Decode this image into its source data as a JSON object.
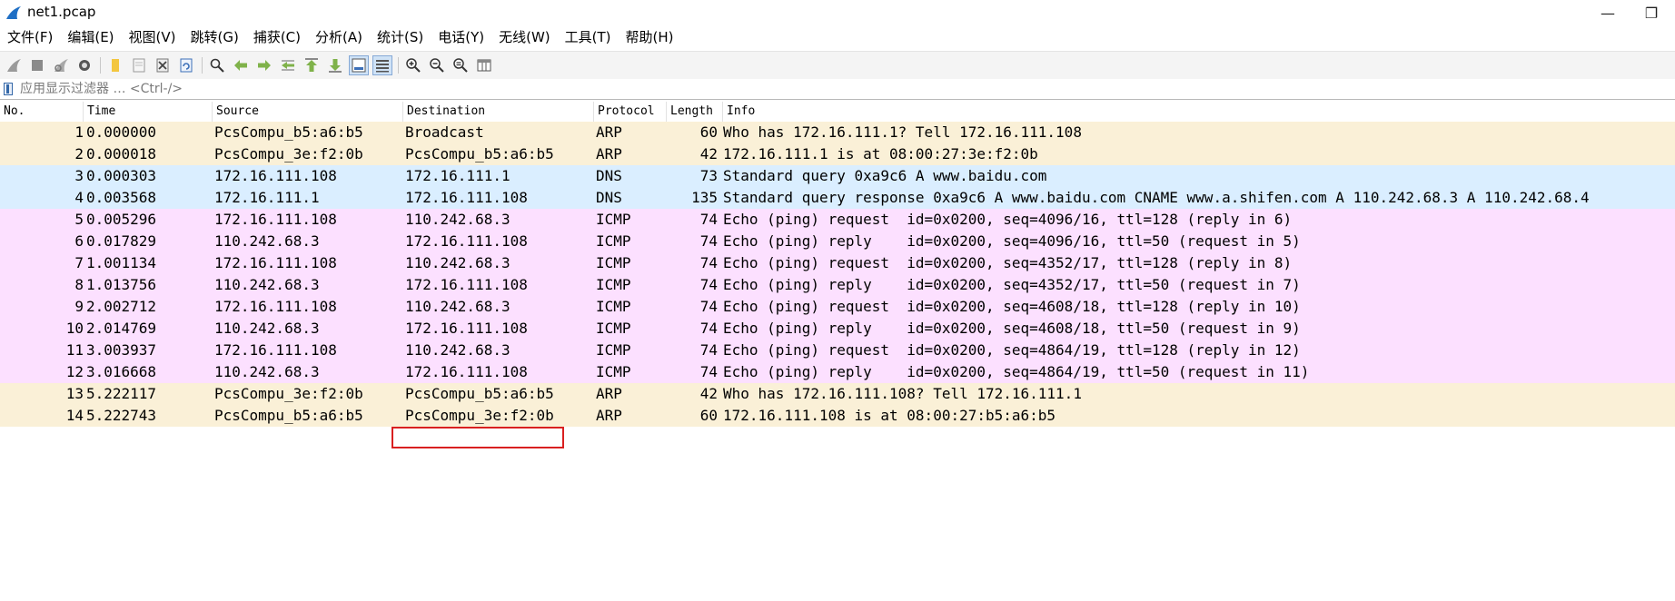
{
  "window": {
    "title": "net1.pcap",
    "minimize_glyph": "—",
    "restore_glyph": "❐"
  },
  "menu": [
    "文件(F)",
    "编辑(E)",
    "视图(V)",
    "跳转(G)",
    "捕获(C)",
    "分析(A)",
    "统计(S)",
    "电话(Y)",
    "无线(W)",
    "工具(T)",
    "帮助(H)"
  ],
  "toolbar": {
    "icons": [
      "shark-fin-start-icon",
      "stop-square-icon",
      "restart-fin-icon",
      "options-gear-icon",
      "open-folder-icon",
      "open-file-icon",
      "close-file-icon",
      "reload-icon",
      "find-magnifier-icon",
      "go-back-arrow-icon",
      "go-forward-arrow-icon",
      "go-to-packet-icon",
      "go-first-icon",
      "go-last-icon",
      "autoscroll-icon",
      "colorize-icon",
      "zoom-in-icon",
      "zoom-out-icon",
      "zoom-normal-icon",
      "resize-columns-icon"
    ]
  },
  "filter": {
    "placeholder": "应用显示过滤器 … <Ctrl-/>"
  },
  "columns": [
    "No.",
    "Time",
    "Source",
    "Destination",
    "Protocol",
    "Length",
    "Info"
  ],
  "colors": {
    "arp": "#faf0d7",
    "udp": "#daeeff",
    "icmp": "#fce0ff",
    "highlight_box": "#d92020"
  },
  "packets": [
    {
      "no": "1",
      "time": "0.000000",
      "src": "PcsCompu_b5:a6:b5",
      "dst": "Broadcast",
      "proto": "ARP",
      "len": "60",
      "info": "Who has 172.16.111.1? Tell 172.16.111.108",
      "color": "arp"
    },
    {
      "no": "2",
      "time": "0.000018",
      "src": "PcsCompu_3e:f2:0b",
      "dst": "PcsCompu_b5:a6:b5",
      "proto": "ARP",
      "len": "42",
      "info": "172.16.111.1 is at 08:00:27:3e:f2:0b",
      "color": "arp"
    },
    {
      "no": "3",
      "time": "0.000303",
      "src": "172.16.111.108",
      "dst": "172.16.111.1",
      "proto": "DNS",
      "len": "73",
      "info": "Standard query 0xa9c6 A www.baidu.com",
      "color": "udp"
    },
    {
      "no": "4",
      "time": "0.003568",
      "src": "172.16.111.1",
      "dst": "172.16.111.108",
      "proto": "DNS",
      "len": "135",
      "info": "Standard query response 0xa9c6 A www.baidu.com CNAME www.a.shifen.com A 110.242.68.3 A 110.242.68.4",
      "color": "udp",
      "boxed": true
    },
    {
      "no": "5",
      "time": "0.005296",
      "src": "172.16.111.108",
      "dst": "110.242.68.3",
      "proto": "ICMP",
      "len": "74",
      "info": "Echo (ping) request  id=0x0200, seq=4096/16, ttl=128 (reply in 6)",
      "color": "icmp"
    },
    {
      "no": "6",
      "time": "0.017829",
      "src": "110.242.68.3",
      "dst": "172.16.111.108",
      "proto": "ICMP",
      "len": "74",
      "info": "Echo (ping) reply    id=0x0200, seq=4096/16, ttl=50 (request in 5)",
      "color": "icmp",
      "boxed": true
    },
    {
      "no": "7",
      "time": "1.001134",
      "src": "172.16.111.108",
      "dst": "110.242.68.3",
      "proto": "ICMP",
      "len": "74",
      "info": "Echo (ping) request  id=0x0200, seq=4352/17, ttl=128 (reply in 8)",
      "color": "icmp"
    },
    {
      "no": "8",
      "time": "1.013756",
      "src": "110.242.68.3",
      "dst": "172.16.111.108",
      "proto": "ICMP",
      "len": "74",
      "info": "Echo (ping) reply    id=0x0200, seq=4352/17, ttl=50 (request in 7)",
      "color": "icmp"
    },
    {
      "no": "9",
      "time": "2.002712",
      "src": "172.16.111.108",
      "dst": "110.242.68.3",
      "proto": "ICMP",
      "len": "74",
      "info": "Echo (ping) request  id=0x0200, seq=4608/18, ttl=128 (reply in 10)",
      "color": "icmp"
    },
    {
      "no": "10",
      "time": "2.014769",
      "src": "110.242.68.3",
      "dst": "172.16.111.108",
      "proto": "ICMP",
      "len": "74",
      "info": "Echo (ping) reply    id=0x0200, seq=4608/18, ttl=50 (request in 9)",
      "color": "icmp"
    },
    {
      "no": "11",
      "time": "3.003937",
      "src": "172.16.111.108",
      "dst": "110.242.68.3",
      "proto": "ICMP",
      "len": "74",
      "info": "Echo (ping) request  id=0x0200, seq=4864/19, ttl=128 (reply in 12)",
      "color": "icmp"
    },
    {
      "no": "12",
      "time": "3.016668",
      "src": "110.242.68.3",
      "dst": "172.16.111.108",
      "proto": "ICMP",
      "len": "74",
      "info": "Echo (ping) reply    id=0x0200, seq=4864/19, ttl=50 (request in 11)",
      "color": "icmp"
    },
    {
      "no": "13",
      "time": "5.222117",
      "src": "PcsCompu_3e:f2:0b",
      "dst": "PcsCompu_b5:a6:b5",
      "proto": "ARP",
      "len": "42",
      "info": "Who has 172.16.111.108? Tell 172.16.111.1",
      "color": "arp"
    },
    {
      "no": "14",
      "time": "5.222743",
      "src": "PcsCompu_b5:a6:b5",
      "dst": "PcsCompu_3e:f2:0b",
      "proto": "ARP",
      "len": "60",
      "info": "172.16.111.108 is at 08:00:27:b5:a6:b5",
      "color": "arp"
    }
  ]
}
